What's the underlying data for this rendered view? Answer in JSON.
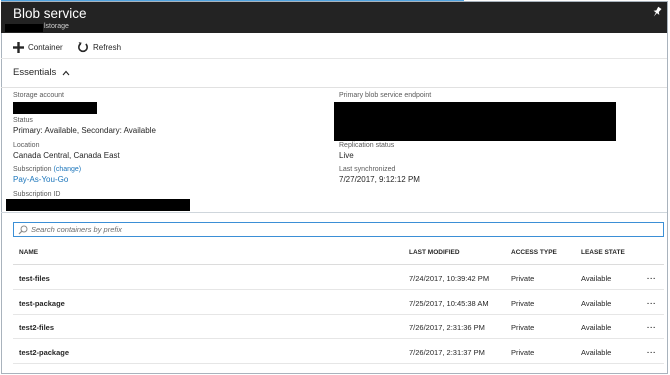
{
  "header": {
    "title": "Blob service",
    "subtitle": "lstorage",
    "pin_icon": "pin-icon"
  },
  "toolbar": {
    "add_container_label": "Container",
    "refresh_label": "Refresh"
  },
  "essentials": {
    "title": "Essentials",
    "storage_account_label": "Storage account",
    "status_label": "Status",
    "status_value": "Primary: Available, Secondary: Available",
    "location_label": "Location",
    "location_value": "Canada Central, Canada East",
    "subscription_label": "Subscription",
    "subscription_change": "(change)",
    "subscription_value": "Pay-As-You-Go",
    "subscription_id_label": "Subscription ID",
    "endpoint_label": "Primary blob service endpoint",
    "replication_label": "Replication status",
    "replication_value": "Live",
    "last_sync_label": "Last synchronized",
    "last_sync_value": "7/27/2017, 9:12:12 PM"
  },
  "search": {
    "placeholder": "Search containers by prefix"
  },
  "table": {
    "columns": [
      "NAME",
      "LAST MODIFIED",
      "ACCESS TYPE",
      "LEASE STATE"
    ],
    "rows": [
      {
        "name": "test-files",
        "modified": "7/24/2017, 10:39:42 PM",
        "access": "Private",
        "lease": "Available",
        "more": "..."
      },
      {
        "name": "test-package",
        "modified": "7/25/2017, 10:45:38 AM",
        "access": "Private",
        "lease": "Available",
        "more": "..."
      },
      {
        "name": "test2-files",
        "modified": "7/26/2017, 2:31:36 PM",
        "access": "Private",
        "lease": "Available",
        "more": "..."
      },
      {
        "name": "test2-package",
        "modified": "7/26/2017, 2:31:37 PM",
        "access": "Private",
        "lease": "Available",
        "more": "..."
      }
    ]
  },
  "colors": {
    "header_bg": "#232323",
    "accent": "#1b75bb",
    "search_border": "#3b8fd6"
  }
}
